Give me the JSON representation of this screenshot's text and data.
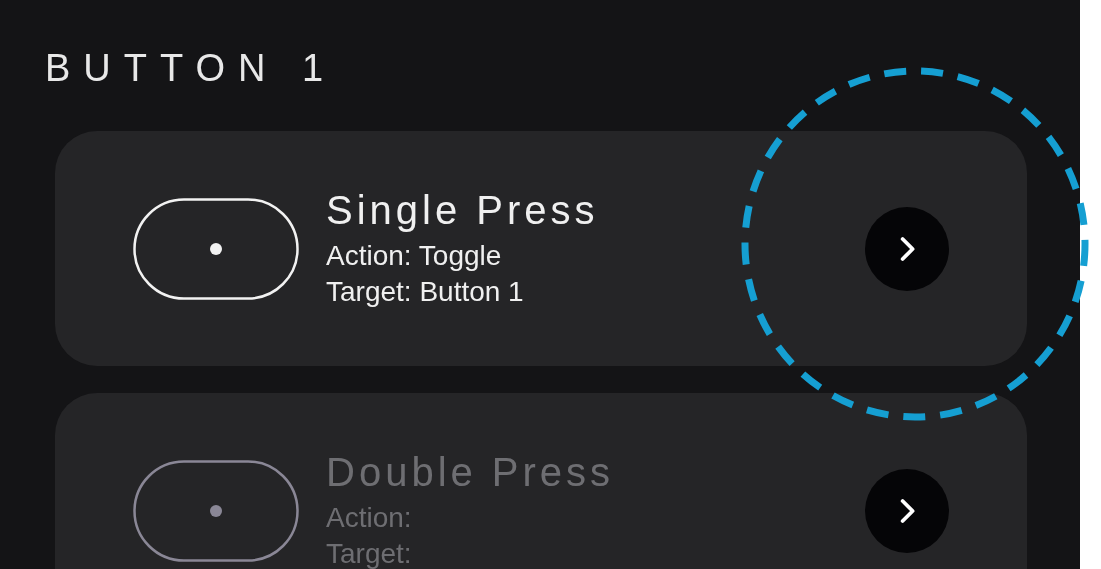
{
  "section": {
    "title": "BUTTON 1"
  },
  "presses": [
    {
      "title": "Single Press",
      "action": "Action: Toggle",
      "target": "Target: Button 1",
      "disabled": false,
      "highlighted": true
    },
    {
      "title": "Double Press",
      "action": "Action:",
      "target": "Target:",
      "disabled": true,
      "highlighted": false
    }
  ]
}
